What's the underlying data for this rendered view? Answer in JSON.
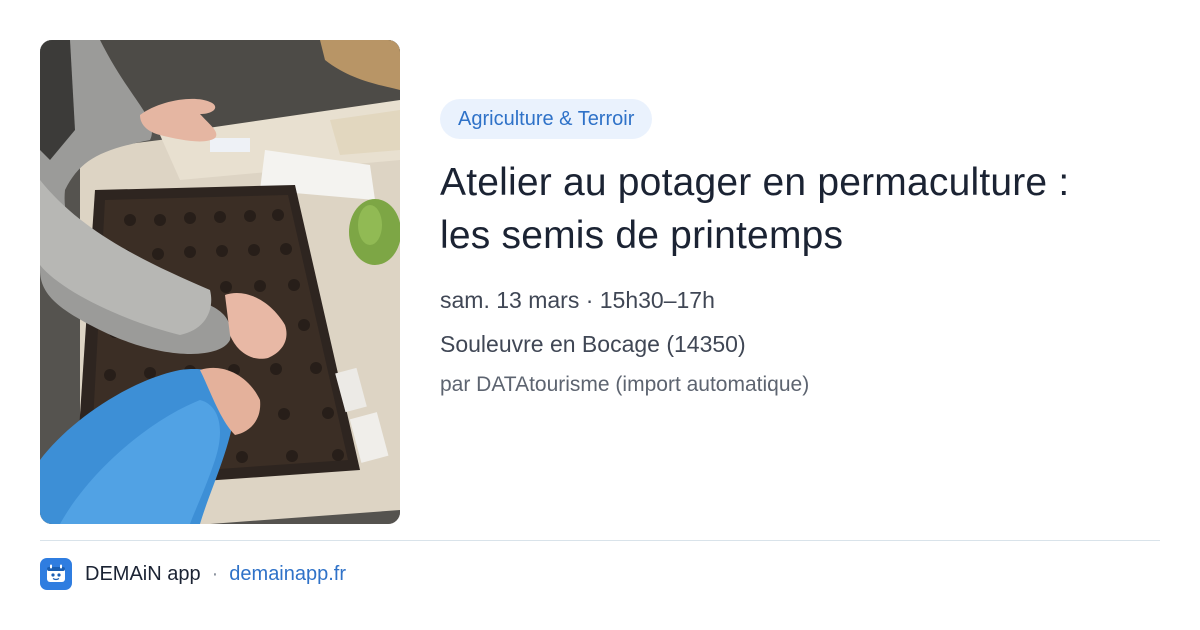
{
  "event": {
    "category": "Agriculture & Terroir",
    "title": "Atelier au potager en permaculture : les semis de printemps",
    "date_time": "sam. 13 mars · 15h30–17h",
    "location": "Souleuvre en Bocage (14350)",
    "source": "par DATAtourisme (import automatique)",
    "photo_icon": "seed-tray-photo"
  },
  "footer": {
    "app_name": "DEMAiN app",
    "separator": "·",
    "link_text": "demainapp.fr",
    "app_icon": "demain-app-icon"
  },
  "colors": {
    "accent": "#2f72c8",
    "badge_bg": "#eaf2fd",
    "title": "#1b2333",
    "divider": "#d9e3ea"
  }
}
